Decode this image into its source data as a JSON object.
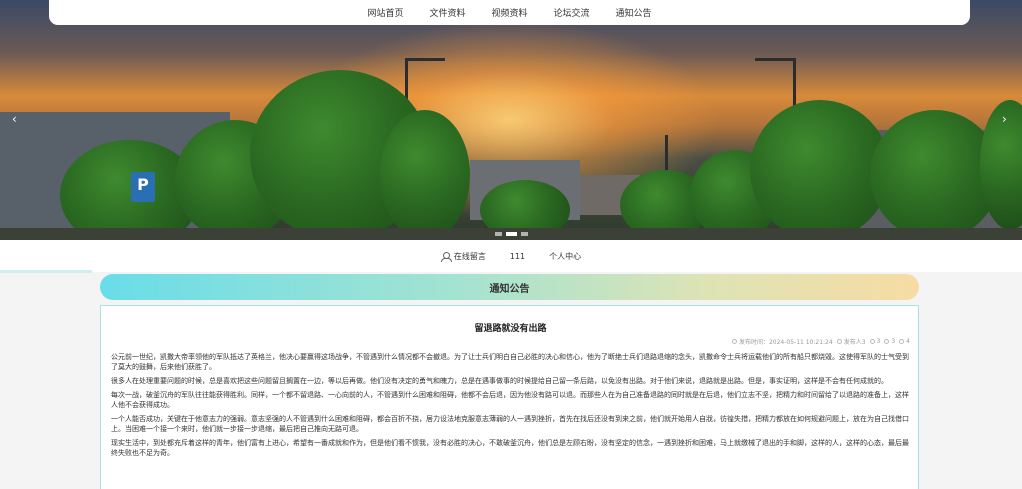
{
  "nav": {
    "items": [
      "网站首页",
      "文件资料",
      "视频资料",
      "论坛交流",
      "通知公告"
    ]
  },
  "carousel": {
    "prev_icon": "chevron-left-icon",
    "next_icon": "chevron-right-icon",
    "slides": 3,
    "active_index": 1,
    "sign_text": "P"
  },
  "subnav": {
    "login": "在线留言",
    "count": "111",
    "profile": "个人中心"
  },
  "section": {
    "title": "通知公告"
  },
  "article": {
    "title": "留退路就没有出路",
    "meta": {
      "time": "发布时间：2024-05-11 10:21:24",
      "author": "发布人3",
      "likes": "3",
      "dislikes": "3",
      "views": "4"
    },
    "paragraphs": [
      "公元前一世纪，凯撒大帝率领他的军队抵达了英格兰，他决心要赢得这场战争，不管遇到什么情况都不会撤退。为了让士兵们明白自己必胜的决心和信心，他为了断绝士兵们退路退缩的念头，凯撒命令士兵将运载他们的所有船只都烧毁。这使得军队的士气受到了莫大的鼓舞，后来他们获胜了。",
      "很多人在处理重要问题的时候，总是喜欢把这些问题留且搁置在一边，等以后再做。他们没有决定的勇气和魄力，总是在遇事做事的时候提给自己留一条后路，以免没有出路。对于他们来说，退路就是出路。但是，事实证明，这样是不会有任何成就的。",
      "每次一战，破釜沉舟的军队往往能获得胜利。同样，一个都不留退路、一心向前的人，不管遇到什么困难和阻碍，他都不会后退，因为他没有路可以退。而那些人在为自己准备退路的同时就是在后退，他们立志不坚，把精力和时间留给了以退路的准备上，这样人他不会获得成功。",
      "一个人能否成功，关键在于他意志力的强弱。意志坚强的人不管遇到什么困难和阻碍，都会百折不挠，居力设法地克服意志薄弱的人一遇到挫折，首先在找后还没有到来之前，他们就开始用人自戕，彷徨失措，把精力都放在如何规避问题上，放在为自己找借口上。当困难一个接一个来时，他们就一步接一步退缩，最后把自己推向无路可退。",
      "现实生活中，到处都充斥着这样的青年，他们富有上进心，希望有一番成就和作为，但是他们看不惯我，没有必胜的决心，不敢破釜沉舟，他们总是左顾右盼，没有坚定的信念，一遇到挫折和困难，马上就缴械了退出的手和脚，这样的人，这样的心态，最后最终失败也不足为奇。"
    ]
  },
  "colors": {
    "header_gradient_start": "#69dde8",
    "header_gradient_end": "#f6dca4",
    "article_border": "#a8e2e6"
  }
}
